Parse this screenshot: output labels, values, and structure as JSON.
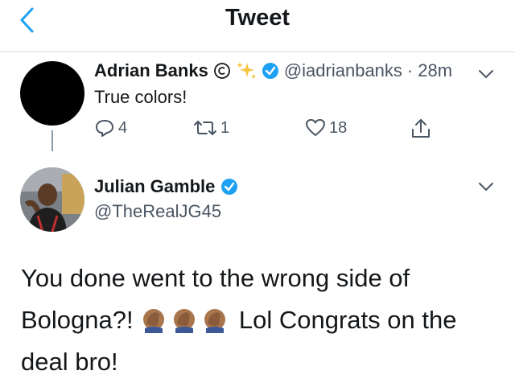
{
  "header": {
    "title": "Tweet",
    "back_icon": "chevron-left-icon"
  },
  "reply_tweet": {
    "author_name": "Adrian Banks",
    "badges": [
      "copyright-icon",
      "sparkles-icon",
      "verified-badge-icon"
    ],
    "handle": "@iadrianbanks",
    "separator": "·",
    "time": "28m",
    "text": "True colors!",
    "actions": {
      "replies": "4",
      "retweets": "1",
      "likes": "18"
    }
  },
  "main_tweet": {
    "author_name": "Julian Gamble",
    "handle": "@TheRealJG45",
    "text_part1": "You done went to the wrong side of Bologna?!",
    "emoji": [
      "facepalm-emoji",
      "facepalm-emoji",
      "facepalm-emoji"
    ],
    "text_part2": "Lol Congrats on the deal bro!"
  },
  "colors": {
    "accent": "#1da1f2",
    "verified": "#1da1f2",
    "muted": "#4a5563",
    "divider": "#d8dde1"
  }
}
